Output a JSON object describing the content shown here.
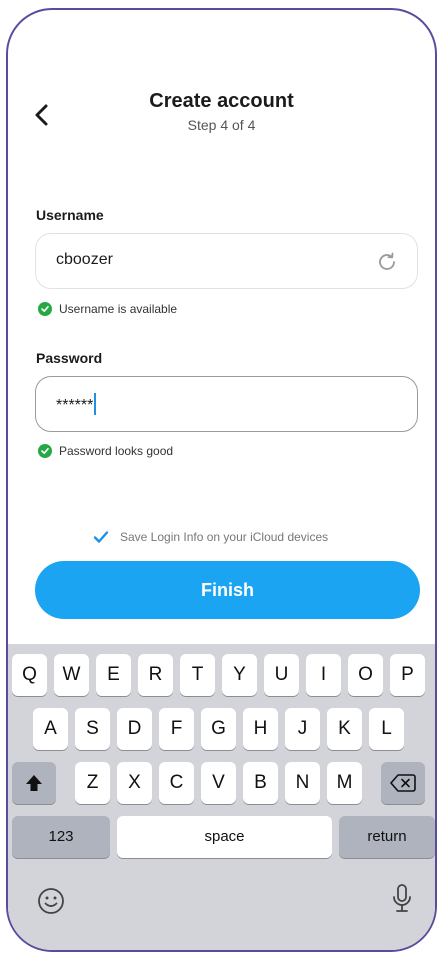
{
  "header": {
    "title": "Create account",
    "step": "Step 4 of 4"
  },
  "username": {
    "label": "Username",
    "value": "cboozer",
    "status": "Username is available"
  },
  "password": {
    "label": "Password",
    "value": "******",
    "status": "Password looks good"
  },
  "save_login": {
    "label": "Save Login Info on your iCloud devices",
    "checked": true
  },
  "finish": {
    "label": "Finish"
  },
  "keyboard": {
    "row1": [
      "Q",
      "W",
      "E",
      "R",
      "T",
      "Y",
      "U",
      "I",
      "O",
      "P"
    ],
    "row2": [
      "A",
      "S",
      "D",
      "F",
      "G",
      "H",
      "J",
      "K",
      "L"
    ],
    "row3": [
      "Z",
      "X",
      "C",
      "V",
      "B",
      "N",
      "M"
    ],
    "numbers": "123",
    "space": "space",
    "return": "return"
  },
  "colors": {
    "accent": "#1aa4f1",
    "success": "#27a847",
    "frame": "#5b4b9e"
  }
}
